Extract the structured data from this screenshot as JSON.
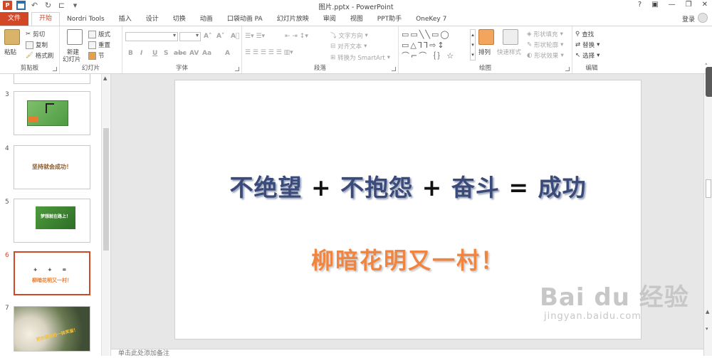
{
  "window": {
    "title": "图片.pptx - PowerPoint",
    "controls": [
      "?",
      "▣",
      "—",
      "❐",
      "✕"
    ],
    "login": "登录"
  },
  "tabs": [
    "文件",
    "开始",
    "Nordri Tools",
    "插入",
    "设计",
    "切换",
    "动画",
    "口袋动画 PA",
    "幻灯片放映",
    "审阅",
    "视图",
    "PPT助手",
    "OneKey 7"
  ],
  "ribbon": {
    "clipboard": {
      "paste": "粘贴",
      "cut": "剪切",
      "copy": "复制",
      "format_painter": "格式刷",
      "label": "剪贴板"
    },
    "slides": {
      "new_slide": "新建",
      "new_slide_2": "幻灯片",
      "layout": "版式",
      "reset": "重置",
      "section": "节",
      "label": "幻灯片"
    },
    "font": {
      "label": "字体",
      "buttons": [
        "B",
        "I",
        "U",
        "S",
        "abc",
        "AV",
        "Aa",
        "A"
      ]
    },
    "paragraph": {
      "text_direction": "文字方向",
      "align_text": "对齐文本",
      "smartart": "转换为 SmartArt",
      "label": "段落"
    },
    "drawing": {
      "arrange": "排列",
      "quick_styles": "快速样式",
      "shape_fill": "形状填充",
      "shape_outline": "形状轮廓",
      "shape_effects": "形状效果",
      "label": "绘图"
    },
    "editing": {
      "find": "查找",
      "replace": "替换",
      "select": "选择",
      "label": "编辑"
    }
  },
  "thumbnails": [
    {
      "num": "3",
      "caption": ""
    },
    {
      "num": "4",
      "caption": "坚持就会成功！"
    },
    {
      "num": "5",
      "caption": "梦想就在路上！"
    },
    {
      "num": "6",
      "caption": "柳暗花明又一村！"
    },
    {
      "num": "7",
      "caption": "把你最美的一抹笑留！"
    }
  ],
  "slide": {
    "line1_parts": [
      "不绝望",
      "+",
      "不抱怨",
      "+",
      "奋斗",
      "=",
      "成功"
    ],
    "line2": "柳暗花明又一村！"
  },
  "notes_placeholder": "单击此处添加备注",
  "watermark": {
    "brand": "Bai du 经验",
    "url": "jingyan.baidu.com"
  },
  "colors": {
    "accent": "#d24726",
    "line1": "#3a4a7a",
    "line2": "#f1853f"
  }
}
